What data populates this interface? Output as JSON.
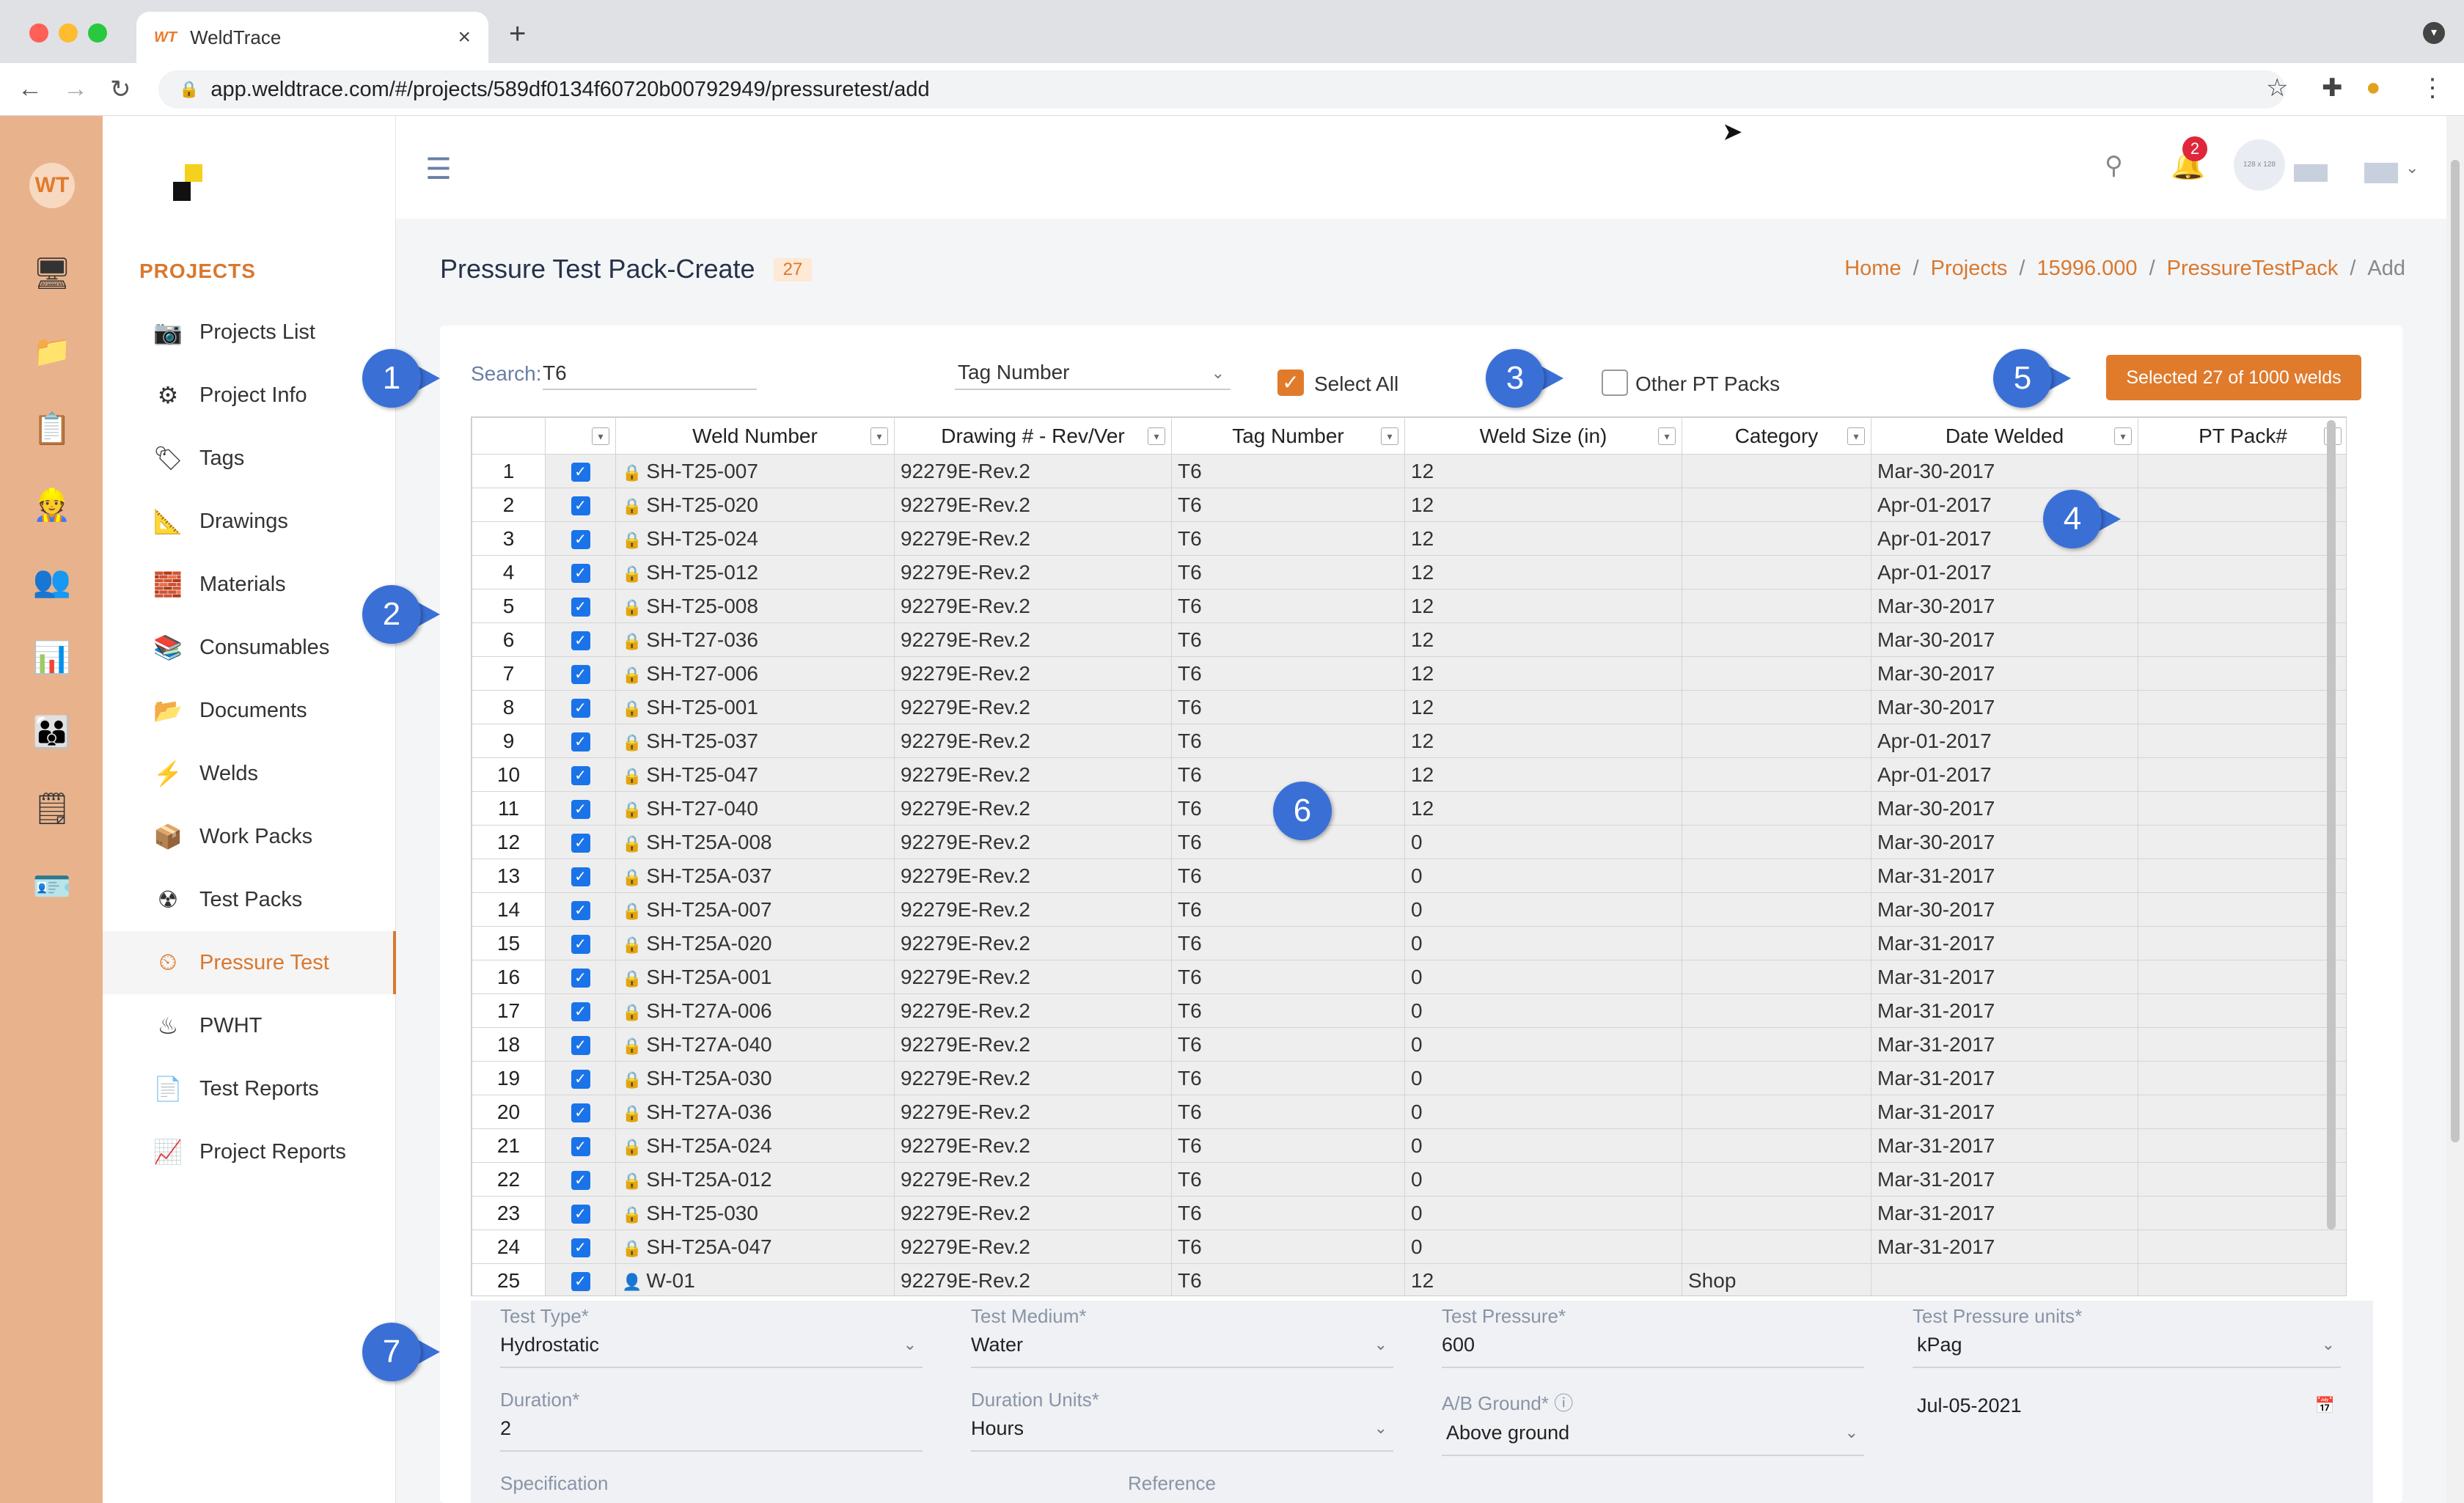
{
  "browser": {
    "tab_title": "WeldTrace",
    "tab_favicon": "WT",
    "url": "app.weldtrace.com/#/projects/589df0134f60720b00792949/pressuretest/add"
  },
  "sidebar": {
    "section_title": "PROJECTS",
    "items": [
      {
        "label": "Projects List",
        "icon": "camera-icon"
      },
      {
        "label": "Project Info",
        "icon": "gears-icon"
      },
      {
        "label": "Tags",
        "icon": "tag-icon"
      },
      {
        "label": "Drawings",
        "icon": "drawing-icon"
      },
      {
        "label": "Materials",
        "icon": "materials-icon"
      },
      {
        "label": "Consumables",
        "icon": "book-icon"
      },
      {
        "label": "Documents",
        "icon": "folder-icon"
      },
      {
        "label": "Welds",
        "icon": "weld-icon"
      },
      {
        "label": "Work Packs",
        "icon": "package-icon"
      },
      {
        "label": "Test Packs",
        "icon": "radiation-icon"
      },
      {
        "label": "Pressure Test",
        "icon": "gauge-icon"
      },
      {
        "label": "PWHT",
        "icon": "heater-icon"
      },
      {
        "label": "Test Reports",
        "icon": "report-icon"
      },
      {
        "label": "Project Reports",
        "icon": "chart-report-icon"
      }
    ],
    "active_item": "Pressure Test"
  },
  "header": {
    "notification_count": "2",
    "avatar_text": "128 x 128"
  },
  "page": {
    "title": "Pressure Test Pack-Create",
    "count": "27",
    "breadcrumbs": [
      "Home",
      "Projects",
      "15996.000",
      "PressureTestPack",
      "Add"
    ]
  },
  "filters": {
    "search_label": "Search:",
    "search_value": "T6",
    "tag_select": "Tag Number",
    "select_all_label": "Select All",
    "other_pt_label": "Other PT Packs",
    "selected_button": "Selected 27 of 1000 welds"
  },
  "table": {
    "columns": [
      "",
      "",
      "Weld Number",
      "Drawing # - Rev/Ver",
      "Tag Number",
      "Weld Size (in)",
      "Category",
      "Date Welded",
      "PT Pack#"
    ],
    "rows": [
      {
        "n": "1",
        "weld": "SH-T25-007",
        "drawing": "92279E-Rev.2",
        "tag": "T6",
        "size": "12",
        "category": "",
        "date": "Mar-30-2017",
        "pack": ""
      },
      {
        "n": "2",
        "weld": "SH-T25-020",
        "drawing": "92279E-Rev.2",
        "tag": "T6",
        "size": "12",
        "category": "",
        "date": "Apr-01-2017",
        "pack": ""
      },
      {
        "n": "3",
        "weld": "SH-T25-024",
        "drawing": "92279E-Rev.2",
        "tag": "T6",
        "size": "12",
        "category": "",
        "date": "Apr-01-2017",
        "pack": ""
      },
      {
        "n": "4",
        "weld": "SH-T25-012",
        "drawing": "92279E-Rev.2",
        "tag": "T6",
        "size": "12",
        "category": "",
        "date": "Apr-01-2017",
        "pack": ""
      },
      {
        "n": "5",
        "weld": "SH-T25-008",
        "drawing": "92279E-Rev.2",
        "tag": "T6",
        "size": "12",
        "category": "",
        "date": "Mar-30-2017",
        "pack": ""
      },
      {
        "n": "6",
        "weld": "SH-T27-036",
        "drawing": "92279E-Rev.2",
        "tag": "T6",
        "size": "12",
        "category": "",
        "date": "Mar-30-2017",
        "pack": ""
      },
      {
        "n": "7",
        "weld": "SH-T27-006",
        "drawing": "92279E-Rev.2",
        "tag": "T6",
        "size": "12",
        "category": "",
        "date": "Mar-30-2017",
        "pack": ""
      },
      {
        "n": "8",
        "weld": "SH-T25-001",
        "drawing": "92279E-Rev.2",
        "tag": "T6",
        "size": "12",
        "category": "",
        "date": "Mar-30-2017",
        "pack": ""
      },
      {
        "n": "9",
        "weld": "SH-T25-037",
        "drawing": "92279E-Rev.2",
        "tag": "T6",
        "size": "12",
        "category": "",
        "date": "Apr-01-2017",
        "pack": ""
      },
      {
        "n": "10",
        "weld": "SH-T25-047",
        "drawing": "92279E-Rev.2",
        "tag": "T6",
        "size": "12",
        "category": "",
        "date": "Apr-01-2017",
        "pack": ""
      },
      {
        "n": "11",
        "weld": "SH-T27-040",
        "drawing": "92279E-Rev.2",
        "tag": "T6",
        "size": "12",
        "category": "",
        "date": "Mar-30-2017",
        "pack": ""
      },
      {
        "n": "12",
        "weld": "SH-T25A-008",
        "drawing": "92279E-Rev.2",
        "tag": "T6",
        "size": "0",
        "category": "",
        "date": "Mar-30-2017",
        "pack": ""
      },
      {
        "n": "13",
        "weld": "SH-T25A-037",
        "drawing": "92279E-Rev.2",
        "tag": "T6",
        "size": "0",
        "category": "",
        "date": "Mar-31-2017",
        "pack": ""
      },
      {
        "n": "14",
        "weld": "SH-T25A-007",
        "drawing": "92279E-Rev.2",
        "tag": "T6",
        "size": "0",
        "category": "",
        "date": "Mar-30-2017",
        "pack": ""
      },
      {
        "n": "15",
        "weld": "SH-T25A-020",
        "drawing": "92279E-Rev.2",
        "tag": "T6",
        "size": "0",
        "category": "",
        "date": "Mar-31-2017",
        "pack": ""
      },
      {
        "n": "16",
        "weld": "SH-T25A-001",
        "drawing": "92279E-Rev.2",
        "tag": "T6",
        "size": "0",
        "category": "",
        "date": "Mar-31-2017",
        "pack": ""
      },
      {
        "n": "17",
        "weld": "SH-T27A-006",
        "drawing": "92279E-Rev.2",
        "tag": "T6",
        "size": "0",
        "category": "",
        "date": "Mar-31-2017",
        "pack": ""
      },
      {
        "n": "18",
        "weld": "SH-T27A-040",
        "drawing": "92279E-Rev.2",
        "tag": "T6",
        "size": "0",
        "category": "",
        "date": "Mar-31-2017",
        "pack": ""
      },
      {
        "n": "19",
        "weld": "SH-T25A-030",
        "drawing": "92279E-Rev.2",
        "tag": "T6",
        "size": "0",
        "category": "",
        "date": "Mar-31-2017",
        "pack": ""
      },
      {
        "n": "20",
        "weld": "SH-T27A-036",
        "drawing": "92279E-Rev.2",
        "tag": "T6",
        "size": "0",
        "category": "",
        "date": "Mar-31-2017",
        "pack": ""
      },
      {
        "n": "21",
        "weld": "SH-T25A-024",
        "drawing": "92279E-Rev.2",
        "tag": "T6",
        "size": "0",
        "category": "",
        "date": "Mar-31-2017",
        "pack": ""
      },
      {
        "n": "22",
        "weld": "SH-T25A-012",
        "drawing": "92279E-Rev.2",
        "tag": "T6",
        "size": "0",
        "category": "",
        "date": "Mar-31-2017",
        "pack": ""
      },
      {
        "n": "23",
        "weld": "SH-T25-030",
        "drawing": "92279E-Rev.2",
        "tag": "T6",
        "size": "0",
        "category": "",
        "date": "Mar-31-2017",
        "pack": ""
      },
      {
        "n": "24",
        "weld": "SH-T25A-047",
        "drawing": "92279E-Rev.2",
        "tag": "T6",
        "size": "0",
        "category": "",
        "date": "Mar-31-2017",
        "pack": ""
      },
      {
        "n": "25",
        "weld": "W-01",
        "drawing": "92279E-Rev.2",
        "tag": "T6",
        "size": "12",
        "category": "Shop",
        "date": "",
        "pack": "",
        "icon": "person-icon"
      }
    ]
  },
  "form": {
    "test_type": {
      "label": "Test Type*",
      "value": "Hydrostatic"
    },
    "test_medium": {
      "label": "Test Medium*",
      "value": "Water"
    },
    "test_pressure": {
      "label": "Test Pressure*",
      "value": "600"
    },
    "test_pressure_units": {
      "label": "Test Pressure units*",
      "value": "kPag"
    },
    "duration": {
      "label": "Duration*",
      "value": "2"
    },
    "duration_units": {
      "label": "Duration Units*",
      "value": "Hours"
    },
    "ab_ground": {
      "label": "A/B Ground*",
      "value": "Above ground"
    },
    "date": {
      "label": "",
      "value": "Jul-05-2021"
    },
    "specification": {
      "label": "Specification"
    },
    "reference": {
      "label": "Reference"
    }
  },
  "annotations": [
    "1",
    "2",
    "3",
    "4",
    "5",
    "6",
    "7"
  ],
  "colors": {
    "accent": "#e07b2c",
    "rail": "#e8b38c",
    "annotation": "#3a6fd6",
    "checkbox": "#1a73e8"
  }
}
